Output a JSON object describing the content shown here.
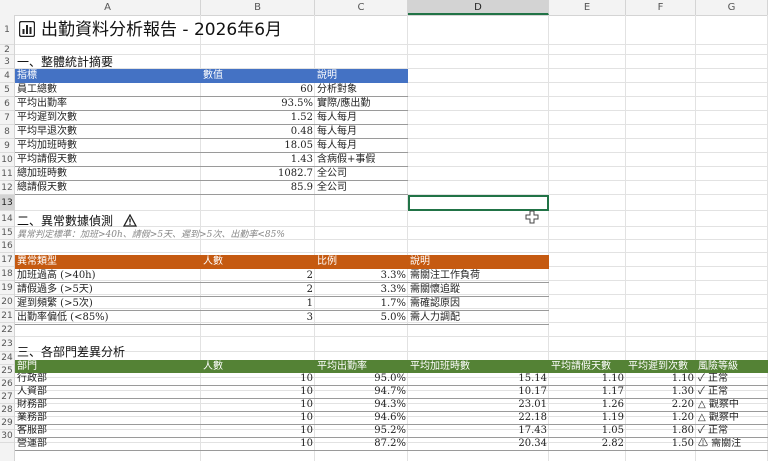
{
  "columns": [
    "A",
    "B",
    "C",
    "D",
    "E",
    "F",
    "G"
  ],
  "selected_column": "D",
  "selected_row": 13,
  "row_numbers": [
    "1",
    "2",
    "3",
    "4",
    "5",
    "6",
    "7",
    "8",
    "9",
    "10",
    "11",
    "12",
    "13",
    "14",
    "15",
    "16",
    "17",
    "18",
    "19",
    "20",
    "21",
    "22",
    "23",
    "24",
    "25",
    "26",
    "27",
    "28",
    "29",
    "30"
  ],
  "title": "出勤資料分析報告 - 2026年6月",
  "icon_title": "bar-chart-icon",
  "section1": {
    "heading": "一、整體統計摘要",
    "headers": [
      "指標",
      "數值",
      "說明"
    ],
    "rows": [
      {
        "label": "員工總數",
        "value": "60",
        "note": "分析對象"
      },
      {
        "label": "平均出勤率",
        "value": "93.5%",
        "note": "實際/應出勤"
      },
      {
        "label": "平均遲到次數",
        "value": "1.52",
        "note": "每人每月"
      },
      {
        "label": "平均早退次數",
        "value": "0.48",
        "note": "每人每月"
      },
      {
        "label": "平均加班時數",
        "value": "18.05",
        "note": "每人每月"
      },
      {
        "label": "平均請假天數",
        "value": "1.43",
        "note": "含病假+事假"
      },
      {
        "label": "總加班時數",
        "value": "1082.7",
        "note": "全公司"
      },
      {
        "label": "總請假天數",
        "value": "85.9",
        "note": "全公司"
      }
    ]
  },
  "section2": {
    "heading": "二、異常數據偵測",
    "heading_icon": "warning-icon",
    "criteria": "異常判定標準：加班>40h、請假>5天、遲到>5次、出勤率<85%",
    "headers": [
      "異常類型",
      "人數",
      "比例",
      "說明"
    ],
    "rows": [
      {
        "type": "加班過高 (>40h)",
        "count": "2",
        "ratio": "3.3%",
        "note": "需關注工作負荷"
      },
      {
        "type": "請假過多 (>5天)",
        "count": "2",
        "ratio": "3.3%",
        "note": "需關懷追蹤"
      },
      {
        "type": "遲到頻繁 (>5次)",
        "count": "1",
        "ratio": "1.7%",
        "note": "需確認原因"
      },
      {
        "type": "出勤率偏低 (<85%)",
        "count": "3",
        "ratio": "5.0%",
        "note": "需人力調配"
      }
    ]
  },
  "section3": {
    "heading": "三、各部門差異分析",
    "headers": [
      "部門",
      "人數",
      "平均出勤率",
      "平均加班時數",
      "平均請假天數",
      "平均遲到次數",
      "風險等級"
    ],
    "rows": [
      {
        "dept": "行政部",
        "count": "10",
        "rate": "95.0%",
        "ot": "15.14",
        "leave": "1.10",
        "late": "1.10",
        "risk": "✓ 正常"
      },
      {
        "dept": "人資部",
        "count": "10",
        "rate": "94.7%",
        "ot": "10.17",
        "leave": "1.17",
        "late": "1.30",
        "risk": "✓ 正常"
      },
      {
        "dept": "財務部",
        "count": "10",
        "rate": "94.3%",
        "ot": "23.01",
        "leave": "1.26",
        "late": "2.20",
        "risk": "△ 觀察中"
      },
      {
        "dept": "業務部",
        "count": "10",
        "rate": "94.6%",
        "ot": "22.18",
        "leave": "1.19",
        "late": "1.20",
        "risk": "△ 觀察中"
      },
      {
        "dept": "客服部",
        "count": "10",
        "rate": "95.2%",
        "ot": "17.43",
        "leave": "1.05",
        "late": "1.80",
        "risk": "✓ 正常"
      },
      {
        "dept": "營運部",
        "count": "10",
        "rate": "87.2%",
        "ot": "20.34",
        "leave": "2.82",
        "late": "1.50",
        "risk": "⚠ 需關注"
      }
    ]
  }
}
